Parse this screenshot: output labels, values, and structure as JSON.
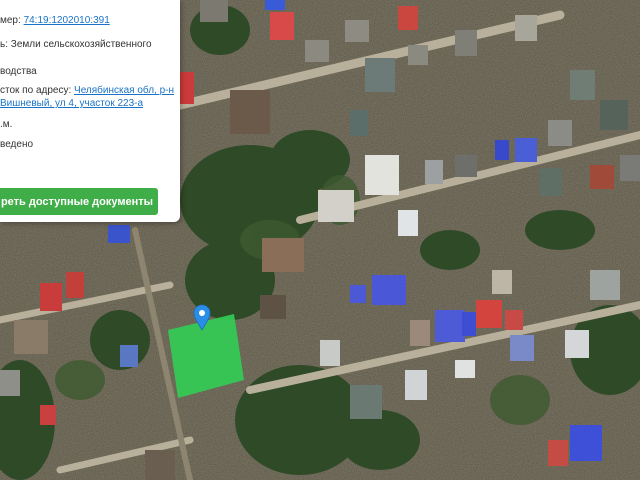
{
  "card": {
    "cadastral_label": "мер:",
    "cadastral_number": "74:19:1202010:391",
    "category_label": "ь:",
    "category_value": "Земли сельскохозяйственного",
    "use_value": "водства",
    "address_label": "сток по адресу:",
    "address_line1": "Челябинская обл, р-н",
    "address_line2": "Вишневый, ул 4, участок 223-а",
    "area_value": ".м.",
    "status_value": "ведено",
    "documents_button": "реть доступные документы"
  },
  "map": {
    "plot_color": "#33cc55",
    "marker_color": "#2a8ee6",
    "marker_icon": "map-pin-icon"
  }
}
